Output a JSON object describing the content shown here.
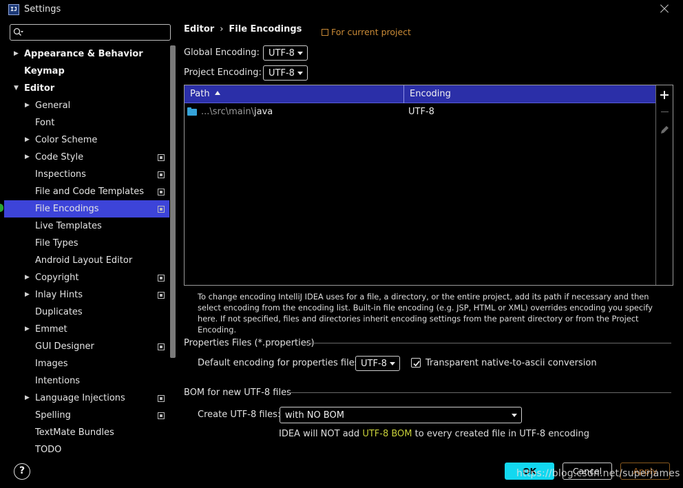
{
  "window": {
    "icon_text": "IJ",
    "title": "Settings"
  },
  "search": {
    "placeholder": "",
    "value": ""
  },
  "tree": {
    "items": [
      {
        "label": "Appearance & Behavior",
        "level": 0,
        "expandable": true,
        "expanded": false,
        "bold": true,
        "project_scope": false,
        "selected": false
      },
      {
        "label": "Keymap",
        "level": 0,
        "expandable": false,
        "expanded": false,
        "bold": true,
        "project_scope": false,
        "selected": false
      },
      {
        "label": "Editor",
        "level": 0,
        "expandable": true,
        "expanded": true,
        "bold": true,
        "project_scope": false,
        "selected": false
      },
      {
        "label": "General",
        "level": 1,
        "expandable": true,
        "expanded": false,
        "bold": false,
        "project_scope": false,
        "selected": false
      },
      {
        "label": "Font",
        "level": 1,
        "expandable": false,
        "expanded": false,
        "bold": false,
        "project_scope": false,
        "selected": false
      },
      {
        "label": "Color Scheme",
        "level": 1,
        "expandable": true,
        "expanded": false,
        "bold": false,
        "project_scope": false,
        "selected": false
      },
      {
        "label": "Code Style",
        "level": 1,
        "expandable": true,
        "expanded": false,
        "bold": false,
        "project_scope": true,
        "selected": false
      },
      {
        "label": "Inspections",
        "level": 1,
        "expandable": false,
        "expanded": false,
        "bold": false,
        "project_scope": true,
        "selected": false
      },
      {
        "label": "File and Code Templates",
        "level": 1,
        "expandable": false,
        "expanded": false,
        "bold": false,
        "project_scope": true,
        "selected": false
      },
      {
        "label": "File Encodings",
        "level": 1,
        "expandable": false,
        "expanded": false,
        "bold": false,
        "project_scope": true,
        "selected": true
      },
      {
        "label": "Live Templates",
        "level": 1,
        "expandable": false,
        "expanded": false,
        "bold": false,
        "project_scope": false,
        "selected": false
      },
      {
        "label": "File Types",
        "level": 1,
        "expandable": false,
        "expanded": false,
        "bold": false,
        "project_scope": false,
        "selected": false
      },
      {
        "label": "Android Layout Editor",
        "level": 1,
        "expandable": false,
        "expanded": false,
        "bold": false,
        "project_scope": false,
        "selected": false
      },
      {
        "label": "Copyright",
        "level": 1,
        "expandable": true,
        "expanded": false,
        "bold": false,
        "project_scope": true,
        "selected": false
      },
      {
        "label": "Inlay Hints",
        "level": 1,
        "expandable": true,
        "expanded": false,
        "bold": false,
        "project_scope": true,
        "selected": false
      },
      {
        "label": "Duplicates",
        "level": 1,
        "expandable": false,
        "expanded": false,
        "bold": false,
        "project_scope": false,
        "selected": false
      },
      {
        "label": "Emmet",
        "level": 1,
        "expandable": true,
        "expanded": false,
        "bold": false,
        "project_scope": false,
        "selected": false
      },
      {
        "label": "GUI Designer",
        "level": 1,
        "expandable": false,
        "expanded": false,
        "bold": false,
        "project_scope": true,
        "selected": false
      },
      {
        "label": "Images",
        "level": 1,
        "expandable": false,
        "expanded": false,
        "bold": false,
        "project_scope": false,
        "selected": false
      },
      {
        "label": "Intentions",
        "level": 1,
        "expandable": false,
        "expanded": false,
        "bold": false,
        "project_scope": false,
        "selected": false
      },
      {
        "label": "Language Injections",
        "level": 1,
        "expandable": true,
        "expanded": false,
        "bold": false,
        "project_scope": true,
        "selected": false
      },
      {
        "label": "Spelling",
        "level": 1,
        "expandable": false,
        "expanded": false,
        "bold": false,
        "project_scope": true,
        "selected": false
      },
      {
        "label": "TextMate Bundles",
        "level": 1,
        "expandable": false,
        "expanded": false,
        "bold": false,
        "project_scope": false,
        "selected": false
      },
      {
        "label": "TODO",
        "level": 1,
        "expandable": false,
        "expanded": false,
        "bold": false,
        "project_scope": false,
        "selected": false
      }
    ]
  },
  "breadcrumb": {
    "parent": "Editor",
    "separator": "›",
    "current": "File Encodings"
  },
  "for_project": "For current project",
  "global_encoding": {
    "label": "Global Encoding:",
    "value": "UTF-8"
  },
  "project_encoding": {
    "label": "Project Encoding:",
    "value": "UTF-8"
  },
  "table": {
    "columns": {
      "path": "Path",
      "encoding": "Encoding"
    },
    "sort": "ascending",
    "rows": [
      {
        "path_prefix": "...\\src\\main\\",
        "path_name": "java",
        "encoding": "UTF-8"
      }
    ]
  },
  "help_text": "To change encoding IntelliJ IDEA uses for a file, a directory, or the entire project, add its path if necessary and then select encoding from the encoding list. Built-in file encoding (e.g. JSP, HTML or XML) overrides encoding you specify here. If not specified, files and directories inherit encoding settings from the parent directory or from the Project Encoding.",
  "properties": {
    "section_title": "Properties Files (*.properties)",
    "default_label": "Default encoding for properties files:",
    "default_value": "UTF-8",
    "native_to_ascii_label": "Transparent native-to-ascii conversion",
    "native_to_ascii_checked": true
  },
  "bom": {
    "section_title": "BOM for new UTF-8 files",
    "create_label": "Create UTF-8 files:",
    "create_value": "with NO BOM",
    "hint_before": "IDEA will NOT add ",
    "hint_highlight": "UTF-8 BOM",
    "hint_after": " to every created file in UTF-8 encoding"
  },
  "buttons": {
    "help": "?",
    "ok": "OK",
    "cancel": "Cancel",
    "apply": "Apply"
  },
  "watermark": "https://blog.csdn.net/superjames",
  "colors": {
    "selection": "#3d44d9",
    "table_header": "#2b2fa8",
    "ok_button": "#12d8f0",
    "project_hint": "#c98a36",
    "bom_highlight": "#c7cf39"
  }
}
